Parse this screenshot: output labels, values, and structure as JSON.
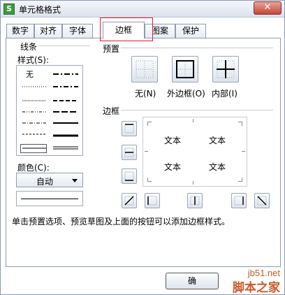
{
  "window": {
    "title": "单元格格式",
    "app_icon_letter": "S",
    "close_glyph": "✕"
  },
  "tabs": [
    {
      "label": "数字",
      "active": false
    },
    {
      "label": "对齐",
      "active": false
    },
    {
      "label": "字体",
      "active": false
    },
    {
      "label": "边框",
      "active": true
    },
    {
      "label": "图案",
      "active": false
    },
    {
      "label": "保护",
      "active": false
    }
  ],
  "line_group": {
    "title": "线条",
    "style_label": "样式(S):",
    "none_label": "无",
    "color_label": "颜色(C):",
    "color_value": "自动"
  },
  "presets": {
    "title": "预置",
    "items": [
      {
        "label": "无(N)",
        "icon": "border-none-icon"
      },
      {
        "label": "外边框(O)",
        "icon": "border-outline-icon"
      },
      {
        "label": "内部(I)",
        "icon": "border-inside-icon"
      }
    ]
  },
  "border": {
    "title": "边框",
    "preview_text": [
      "文本",
      "文本",
      "文本",
      "文本"
    ]
  },
  "hint": "单击预置选项、预览草图及上面的按钮可以添加边框样式。",
  "buttons": {
    "ok": "确"
  },
  "watermark": {
    "top": "jb51.net",
    "bottom": "脚本之家"
  },
  "colors": {
    "highlight": "#e0202a",
    "titlebar": "#dbe3ee",
    "close": "#c4463a"
  }
}
